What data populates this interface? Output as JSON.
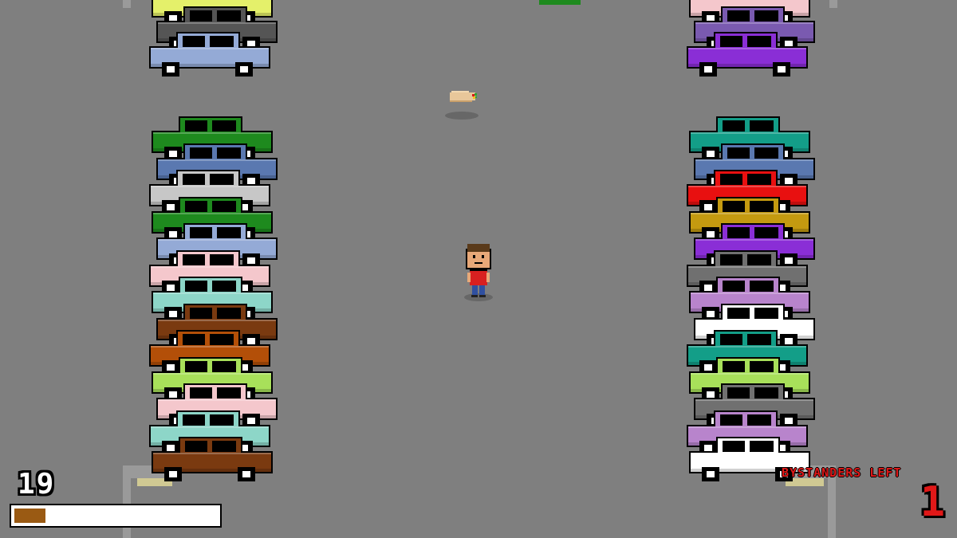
{
  "hud": {
    "score": "19",
    "meter_fill_fraction": 0.15,
    "meter_color": "#9a5a13",
    "bystanders_label": "BYSTANDERS LEFT",
    "bystanders_count": "1",
    "label_color": "#e01818"
  },
  "scene": {
    "ground_color": "#7f7f7f",
    "left_column_cars_top": [
      "#e4f06a",
      "#555555",
      "#94aad6"
    ],
    "left_column_cars_bottom": [
      "#1e8a1e",
      "#5a78b0",
      "#c7c7c7",
      "#1e8a1e",
      "#94aad6",
      "#f4c7cc",
      "#8dd6c8",
      "#7a3a10",
      "#b34f08",
      "#a8e05a",
      "#f4c7cc",
      "#8dd6c8",
      "#7a3a10"
    ],
    "right_column_cars_top": [
      "#f4c7cc",
      "#7a5ab0",
      "#8a2ed6"
    ],
    "right_column_cars_bottom": [
      "#139e88",
      "#5a78b0",
      "#e81010",
      "#c49a10",
      "#8a2ed6",
      "#707070",
      "#b884cc",
      "#ffffff",
      "#139e88",
      "#a8e05a",
      "#707070",
      "#b884cc",
      "#ffffff"
    ],
    "player_icon": "pixel-boy-red-shirt",
    "item_icon": "burrito-icon"
  }
}
